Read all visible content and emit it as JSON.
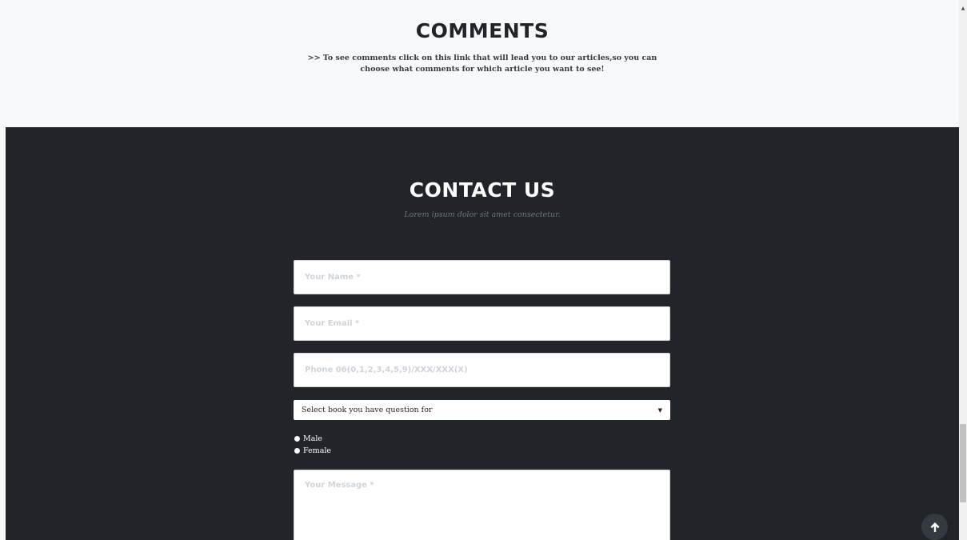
{
  "comments": {
    "title": "COMMENTS",
    "text": ">> To see comments click on this link that will lead you to our articles,so you can choose what comments for which article you want to see!"
  },
  "contact": {
    "title": "CONTACT US",
    "subheading": "Lorem ipsum dolor sit amet consectetur.",
    "name_placeholder": "Your Name *",
    "email_placeholder": "Your Email *",
    "phone_placeholder": "Phone 06(0,1,2,3,4,5,9)/XXX/XXX(X)",
    "book_select_value": "Select book you have question for",
    "gender_options": [
      "Male",
      "Female"
    ],
    "message_placeholder": "Your Message *"
  },
  "icons": {
    "back_to_top": "arrow-up-icon",
    "select_arrow": "caret-down-icon",
    "scroll_up": "scroll-up-arrow-icon"
  },
  "colors": {
    "dark_section": "#212529",
    "light_section": "#f8f9fa",
    "button": "#343a40"
  }
}
